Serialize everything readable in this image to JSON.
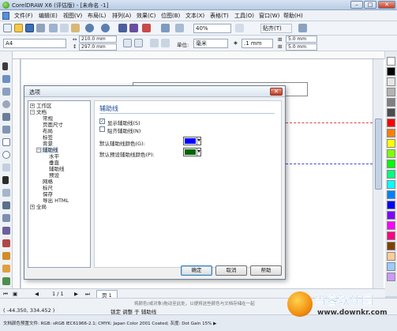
{
  "window": {
    "title": "CorelDRAW X6 (评估版) - [未命名 -1]",
    "buttons": {
      "minimize": "–",
      "maximize": "□",
      "close": "✕"
    }
  },
  "menubar": {
    "items": [
      "文件(F)",
      "编辑(E)",
      "视图(V)",
      "布局(L)",
      "排列(A)",
      "效果(C)",
      "位图(B)",
      "文本(X)",
      "表格(T)",
      "工具(O)",
      "窗口(W)",
      "帮助(H)"
    ]
  },
  "toolbar": {
    "zoom": "40%",
    "snap": "贴齐(T)"
  },
  "propertybar": {
    "paper": "A4",
    "width": "210.0 mm",
    "height": "297.0 mm",
    "unit_label": "单位:",
    "unit": "毫米",
    "nudge": ".1 mm",
    "dup_x": "5.0 mm",
    "dup_y": "5.0 mm"
  },
  "dialog": {
    "title": "选项",
    "close_label": "✕",
    "tree": [
      {
        "label": "工作区",
        "toggle": "+",
        "level": 0
      },
      {
        "label": "文档",
        "toggle": "−",
        "level": 0
      },
      {
        "label": "常规",
        "level": 1
      },
      {
        "label": "页面尺寸",
        "level": 1
      },
      {
        "label": "布局",
        "level": 1
      },
      {
        "label": "标签",
        "level": 1
      },
      {
        "label": "背景",
        "level": 1
      },
      {
        "label": "辅助线",
        "toggle": "−",
        "level": 1
      },
      {
        "label": "水平",
        "level": 2
      },
      {
        "label": "垂直",
        "level": 2
      },
      {
        "label": "辅助线",
        "level": 2
      },
      {
        "label": "预设",
        "level": 2
      },
      {
        "label": "网格",
        "level": 1
      },
      {
        "label": "标尺",
        "level": 1
      },
      {
        "label": "保存",
        "level": 1
      },
      {
        "label": "导出 HTML",
        "level": 1
      },
      {
        "label": "全局",
        "toggle": "+",
        "level": 0
      }
    ],
    "panel": {
      "title": "辅助线",
      "show_guides": {
        "label": "显示辅助线(S)",
        "checked": true
      },
      "snap_guides": {
        "label": "贴齐辅助线(N)",
        "checked": false
      },
      "guide_color": {
        "label": "默认辅助线颜色(G):",
        "color": "#0000ff"
      },
      "preset_color": {
        "label": "默认预设辅助线颜色(P):",
        "color": "#006400"
      }
    },
    "buttons": {
      "ok": "确定",
      "cancel": "取消",
      "help": "帮助"
    }
  },
  "bottom_bar": {
    "page_count": "1 / 1",
    "page_tab": "页 1"
  },
  "status": {
    "hint": "将颜色(或对象)拖动至此处，以便将这些颜色与文档存储在一起",
    "coords": "( -44.350, 334.452 )",
    "mode": "锁定 调整 于 辅助线",
    "profile": "文档颜色预置文件: RGB: sRGB IEC61966-2.1; CMYK: Japan Color 2001 Coated; 灰度: Dot Gain 15% ▶"
  },
  "watermark": {
    "main": "当客软件园",
    "sub": "www.downkr.com"
  },
  "palette_colors": [
    "#ffffff",
    "#000000",
    "#e5e5e5",
    "#b3b3b3",
    "#808080",
    "#4d4d4d",
    "#ff0000",
    "#ff8000",
    "#ffff00",
    "#80ff00",
    "#00ff00",
    "#00ff80",
    "#00ffff",
    "#0080ff",
    "#0000ff",
    "#8000ff",
    "#ff00ff",
    "#ff0080",
    "#804000",
    "#ffcc99",
    "#99ccff",
    "#cc99ff"
  ],
  "colors": {
    "guide_red": "#d04a4a",
    "guide_blue": "#3d4cc8",
    "selection": "#d7e6f8"
  }
}
